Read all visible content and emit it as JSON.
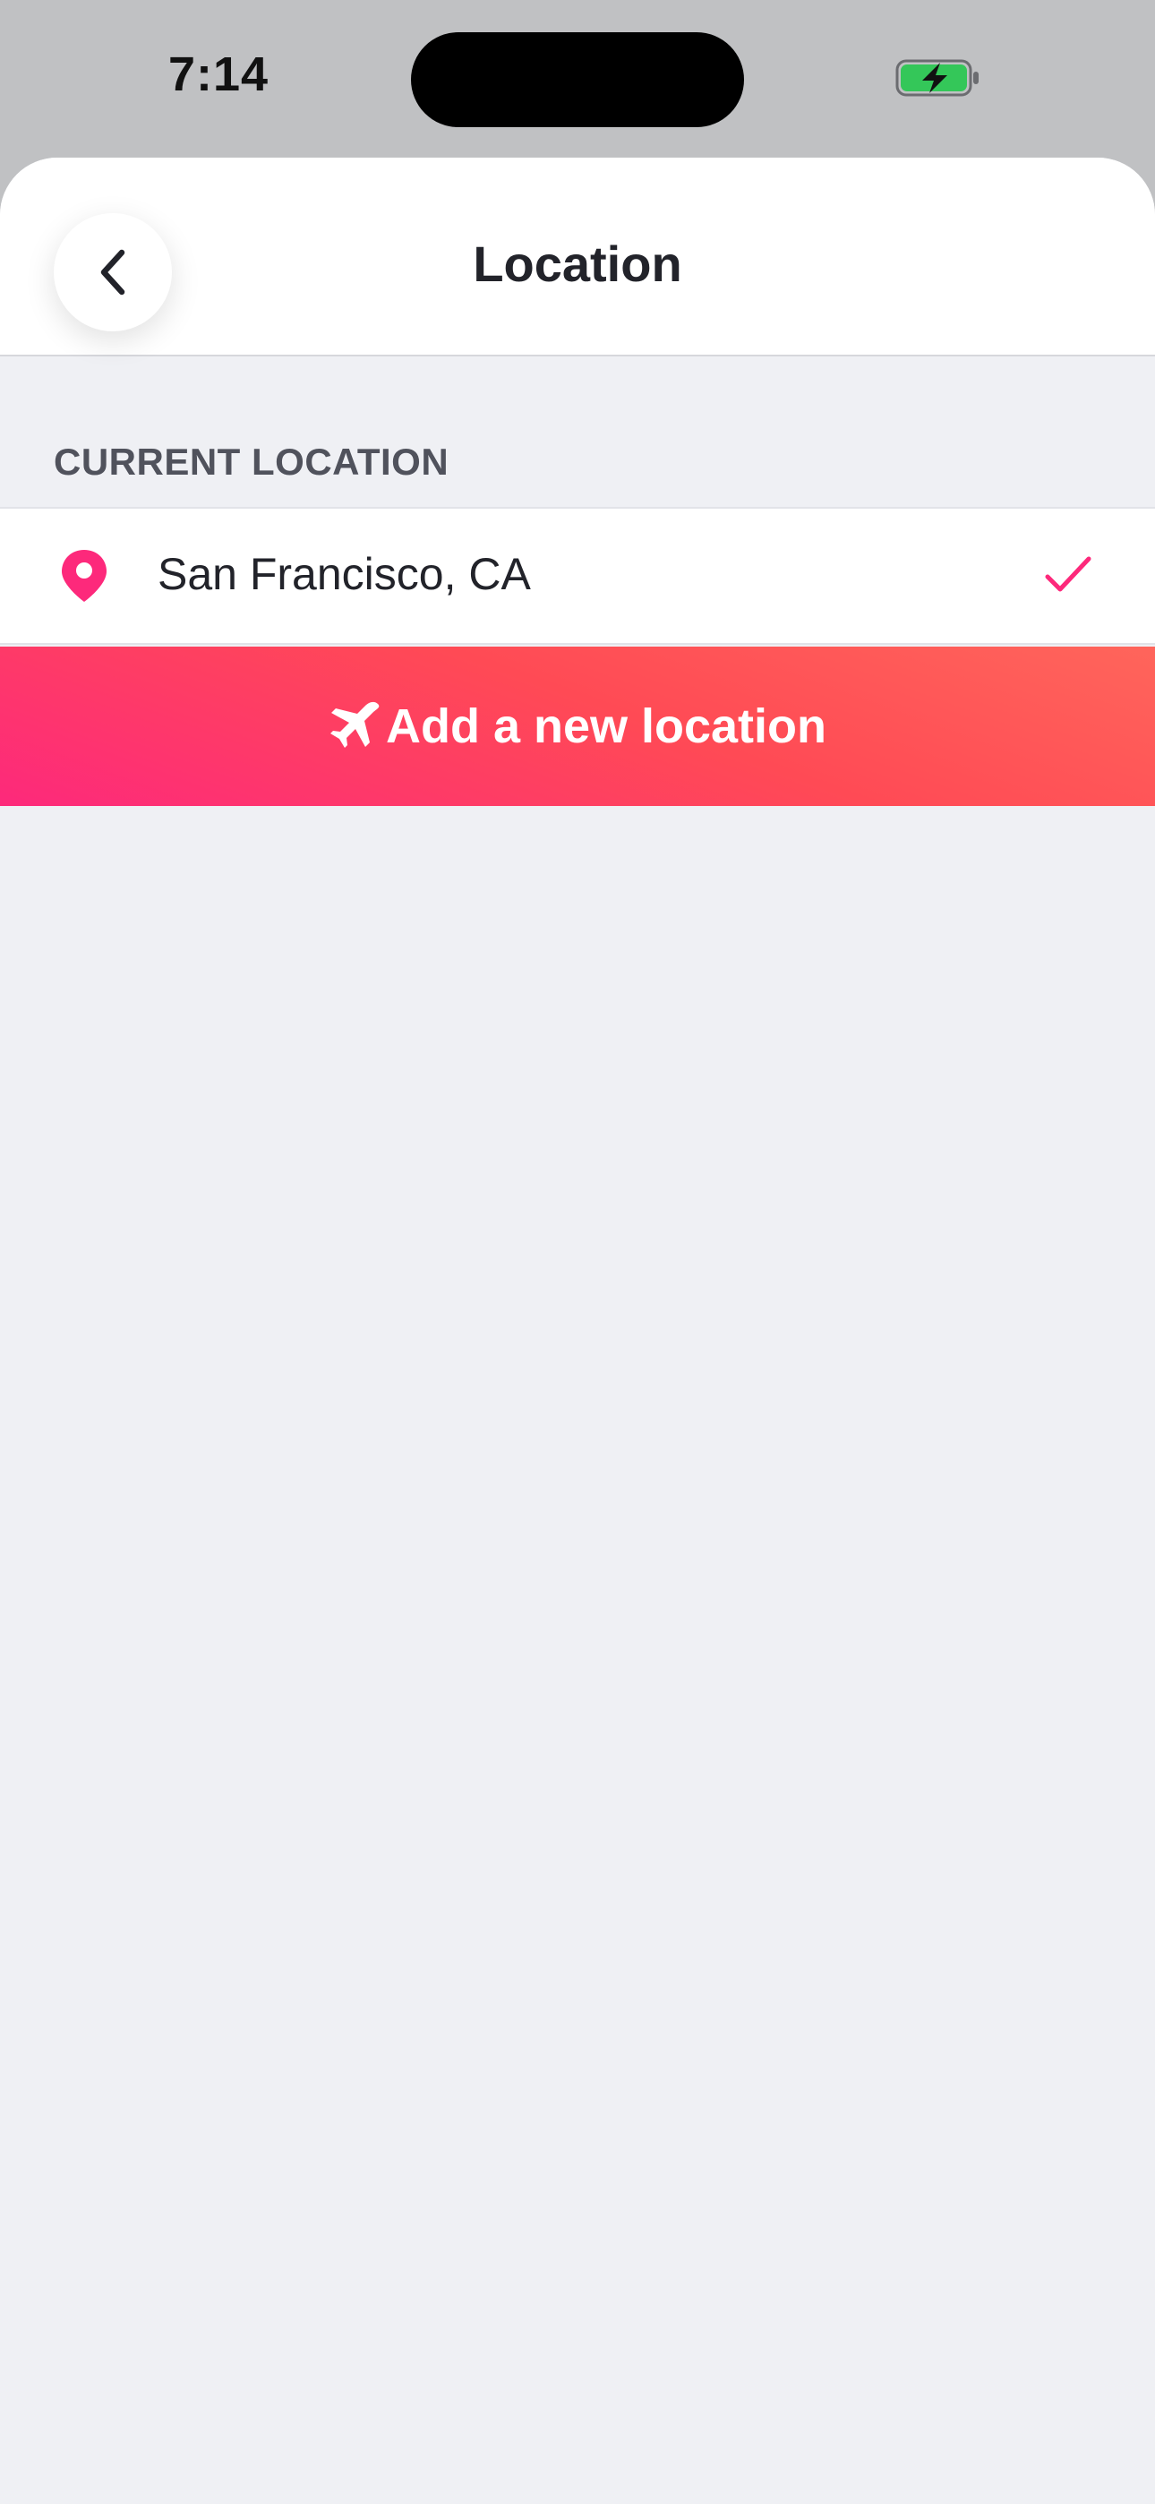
{
  "status_bar": {
    "time": "7:14",
    "battery_color": "#34c759"
  },
  "header": {
    "title": "Location",
    "back_icon": "chevron-left-icon"
  },
  "current_location": {
    "section_label": "CURRENT LOCATION",
    "items": [
      {
        "name": "San Francisco, CA",
        "icon": "map-pin-icon",
        "selected": true
      }
    ]
  },
  "add_location": {
    "label": "Add a new location",
    "icon": "airplane-icon"
  },
  "colors": {
    "accent": "#fd297b",
    "gradient_end": "#ff655b",
    "background": "#eff0f4"
  }
}
